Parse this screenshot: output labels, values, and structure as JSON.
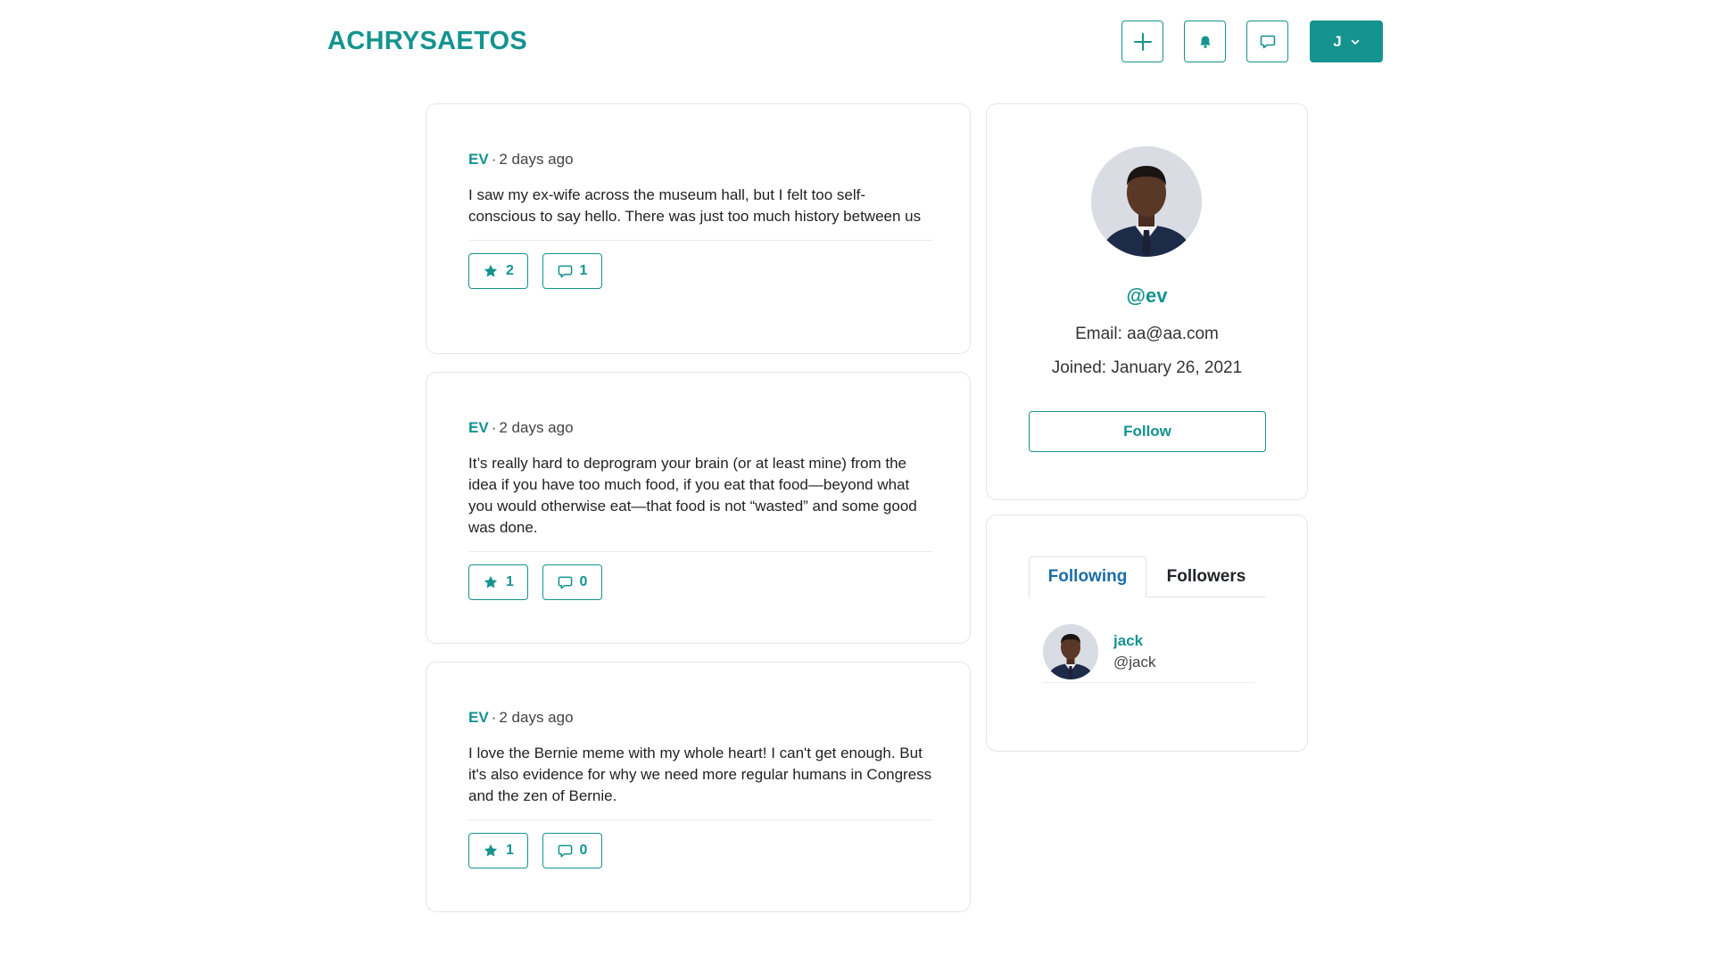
{
  "app": {
    "brand": "ACHRYSAETOS",
    "accent_color": "#14938f"
  },
  "header": {
    "buttons": [
      {
        "icon": "plus-icon"
      },
      {
        "icon": "bell-icon"
      },
      {
        "icon": "chat-icon"
      }
    ],
    "user_menu": {
      "initial": "J",
      "icon": "chevron-down-icon"
    }
  },
  "posts": [
    {
      "author": "EV",
      "time": "2 days ago",
      "body": "I saw my ex-wife across the museum hall, but I felt too self-conscious to say hello. There was just too much history between us",
      "stars": "2",
      "comments": "1"
    },
    {
      "author": "EV",
      "time": "2 days ago",
      "body": "It’s really hard to deprogram your brain (or at least mine) from the idea if you have too much food, if you eat that food—beyond what you would otherwise eat—that food is not “wasted” and some good was done.",
      "stars": "1",
      "comments": "0"
    },
    {
      "author": "EV",
      "time": "2 days ago",
      "body": "I love the Bernie meme with my whole heart! I can't get enough. But it's also evidence for why we need more regular humans in Congress and the zen of Bernie.",
      "stars": "1",
      "comments": "0"
    }
  ],
  "profile": {
    "handle": "@ev",
    "email": "Email: aa@aa.com",
    "joined": "Joined: January 26, 2021",
    "follow_label": "Follow"
  },
  "follows": {
    "tabs": [
      "Following",
      "Followers"
    ],
    "active_tab": "Following",
    "users": [
      {
        "name": "jack",
        "handle": "@jack"
      }
    ]
  }
}
